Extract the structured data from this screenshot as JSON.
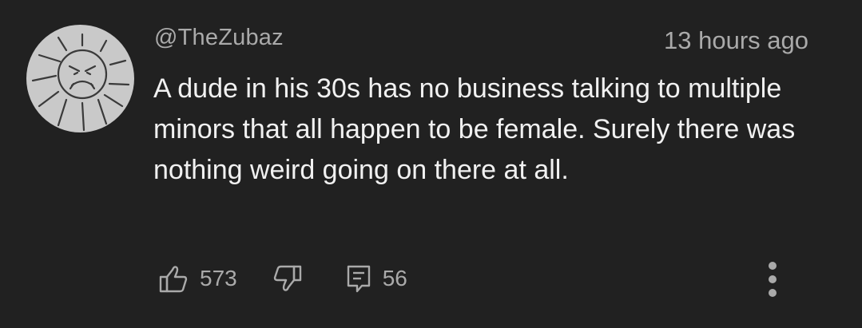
{
  "comment": {
    "author": "@TheZubaz",
    "timestamp": "13 hours ago",
    "text": "A dude in his 30s has no business talking to multiple minors that all happen to be female. Surely there was nothing weird going on there at all.",
    "likes": "573",
    "replies": "56"
  },
  "icons": {
    "avatar": "angry-sun-avatar",
    "like": "thumbs-up-icon",
    "dislike": "thumbs-down-icon",
    "reply": "comment-icon",
    "more": "more-vertical-icon"
  },
  "colors": {
    "background": "#212121",
    "text_primary": "#f1f1f1",
    "text_secondary": "#aaaaaa"
  }
}
